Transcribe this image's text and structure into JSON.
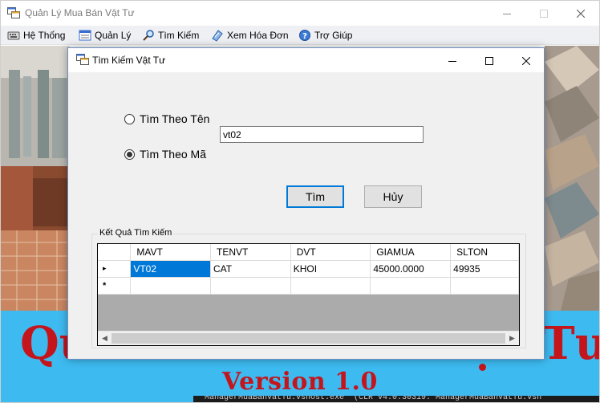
{
  "main_window": {
    "title": "Quản Lý Mua Bán Vật Tư",
    "icon": "app-window-icon"
  },
  "menu": {
    "items": [
      {
        "label": "Hệ Thống",
        "icon": "keyboard-icon"
      },
      {
        "label": "Quản Lý",
        "icon": "window-list-icon"
      },
      {
        "label": "Tìm Kiếm",
        "icon": "magnifier-icon"
      },
      {
        "label": "Xem Hóa Đơn",
        "icon": "document-icon"
      },
      {
        "label": "Trợ Giúp",
        "icon": "help-globe-icon"
      }
    ]
  },
  "banner": {
    "left_text": "Qu",
    "right_text": "Tư",
    "version": "Version 1.0",
    "console_text": "ManagerMuaBanVatTu.vshost.exe' (CLR v4.0.30319: ManagerMuaBanVatTu.vsh",
    "color": "#c4151c",
    "background": "#3dbaf0"
  },
  "dialog": {
    "title": "Tìm Kiếm Vật Tư",
    "radio_name_label": "Tìm Theo Tên",
    "radio_code_label": "Tìm Theo Mã",
    "selected_radio": "code",
    "search_value": "vt02",
    "search_button": "Tìm",
    "cancel_button": "Hủy",
    "results_group_label": "Kết Quả Tìm Kiếm",
    "grid": {
      "columns": [
        "MAVT",
        "TENVT",
        "DVT",
        "GIAMUA",
        "SLTON"
      ],
      "rows": [
        [
          "VT02",
          "CAT",
          "KHOI",
          "45000.0000",
          "49935"
        ]
      ],
      "new_row_marker": "*",
      "current_row_marker": "▸"
    },
    "accent": "#0078d7"
  }
}
